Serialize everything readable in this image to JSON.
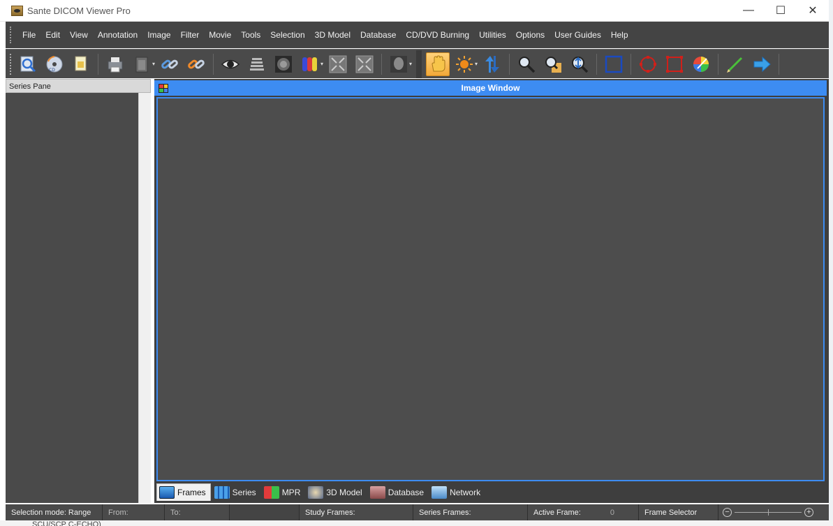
{
  "window": {
    "title": "Sante DICOM Viewer Pro",
    "minimize_glyph": "—",
    "maximize_glyph": "☐",
    "close_glyph": "✕"
  },
  "menu": [
    "File",
    "Edit",
    "View",
    "Annotation",
    "Image",
    "Filter",
    "Movie",
    "Tools",
    "Selection",
    "3D Model",
    "Database",
    "CD/DVD Burning",
    "Utilities",
    "Options",
    "User Guides",
    "Help"
  ],
  "toolbar": {
    "buttons": [
      "open-file-icon",
      "open-cd-icon",
      "open-document-icon",
      "print-icon",
      "clipboard-icon",
      "link-icon",
      "unlink-icon",
      "eye-icon",
      "stack-icon",
      "head-scan-icon",
      "colormap-icon",
      "fit-window-icon",
      "fullscreen-icon",
      "portrait-icon",
      "pan-hand-icon",
      "brightness-icon",
      "scroll-arrows-icon",
      "magnify-icon",
      "magnifier-region-icon",
      "zoom-fit-icon",
      "rectangle-roi-icon",
      "circle-roi-icon",
      "square-roi-icon",
      "color-wheel-icon",
      "pencil-icon",
      "arrow-right-icon"
    ],
    "active": "pan-hand-icon"
  },
  "series_pane": {
    "header": "Series Pane"
  },
  "image_window": {
    "title": "Image Window"
  },
  "tabs": [
    {
      "label": "Frames",
      "icon": "frames-icon",
      "active": true
    },
    {
      "label": "Series",
      "icon": "series-icon",
      "active": false
    },
    {
      "label": "MPR",
      "icon": "mpr-icon",
      "active": false
    },
    {
      "label": "3D Model",
      "icon": "3d-model-icon",
      "active": false
    },
    {
      "label": "Database",
      "icon": "database-icon",
      "active": false
    },
    {
      "label": "Network",
      "icon": "network-icon",
      "active": false
    }
  ],
  "status": {
    "selection_mode": "Selection mode: Range",
    "from": "From:",
    "to": "To:",
    "study_frames": "Study Frames:",
    "series_frames": "Series Frames:",
    "active_frame": "Active Frame:",
    "active_frame_value": "0",
    "frame_selector": "Frame Selector",
    "zoom_minus": "−",
    "zoom_plus": "+"
  },
  "background_text": "SCU/SCP    C-ECHO)"
}
